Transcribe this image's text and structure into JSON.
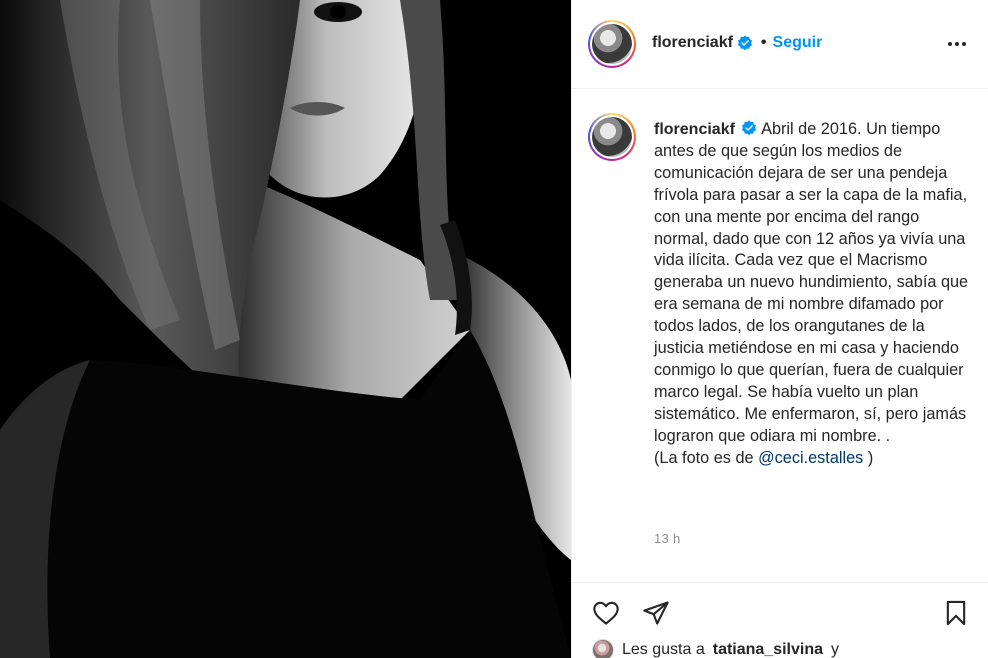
{
  "post": {
    "username": "florenciakf",
    "follow_label": "Seguir",
    "dot": "•",
    "caption_text": "Abril de 2016. Un tiempo antes de que según los medios de comunicación dejara de ser una pendeja frívola para pasar a ser la capa de la mafia, con una mente por encima del rango normal, dado que con 12 años ya vivía una vida ilícita. Cada vez que el Macrismo generaba un nuevo hundimiento, sabía que era semana de mi nombre difamado por todos lados, de los orangutanes de la justicia metiéndose en mi casa y haciendo conmigo lo que querían, fuera de cualquier marco legal. Se había vuelto un plan sistemático. Me enfermaron, sí, pero jamás lograron que odiara mi nombre. .",
    "photo_credit_prefix": "(La foto es de",
    "photo_credit_mention": "@ceci.estalles",
    "photo_credit_suffix": ")",
    "time": "13 h"
  },
  "likes": {
    "prefix": "Les gusta a",
    "user": "tatiana_silvina",
    "suffix": "y"
  },
  "icons": {
    "verified": "verified-badge-icon",
    "more": "more-options-icon",
    "like": "heart-icon",
    "share": "paper-plane-icon",
    "save": "bookmark-icon"
  },
  "colors": {
    "accent": "#0095f6",
    "verified": "#0095f6",
    "mention": "#00376b",
    "secondary_text": "#8e8e8e",
    "border": "#efefef"
  }
}
